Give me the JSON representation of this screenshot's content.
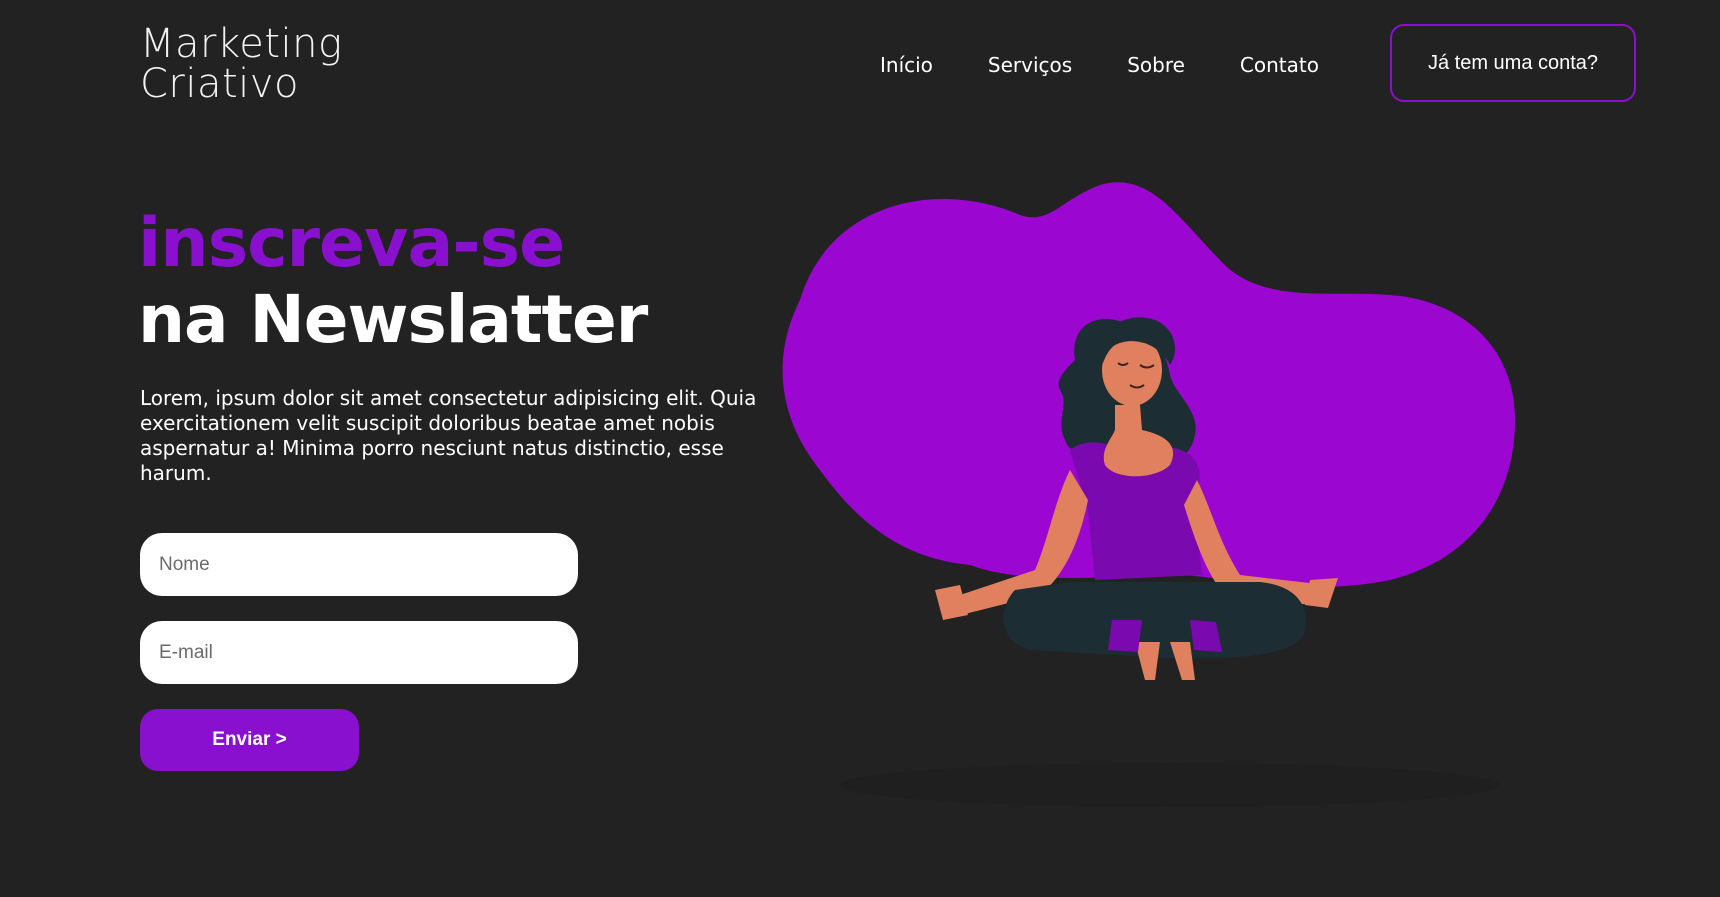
{
  "header": {
    "logo_line1": "Marketing",
    "logo_line2": "Criativo",
    "nav": [
      {
        "label": "Início"
      },
      {
        "label": "Serviços"
      },
      {
        "label": "Sobre"
      },
      {
        "label": "Contato"
      }
    ],
    "account_button": "Já tem uma conta?"
  },
  "hero": {
    "title_line1": "inscreva-se",
    "title_line2": "na Newslatter",
    "description": "Lorem, ipsum dolor sit amet consectetur adipisicing elit. Quia exercitationem velit suscipit doloribus beatae amet nobis aspernatur a! Minima porro nesciunt natus distinctio, esse harum."
  },
  "form": {
    "name_placeholder": "Nome",
    "email_placeholder": "E-mail",
    "send_label": "Enviar >"
  },
  "colors": {
    "background": "#222223",
    "accent": "#8a10cf",
    "blob": "#9b06d1",
    "skin": "#e0805f",
    "hair": "#1c2e33"
  },
  "illustration": {
    "icon": "meditating-woman-illustration"
  }
}
